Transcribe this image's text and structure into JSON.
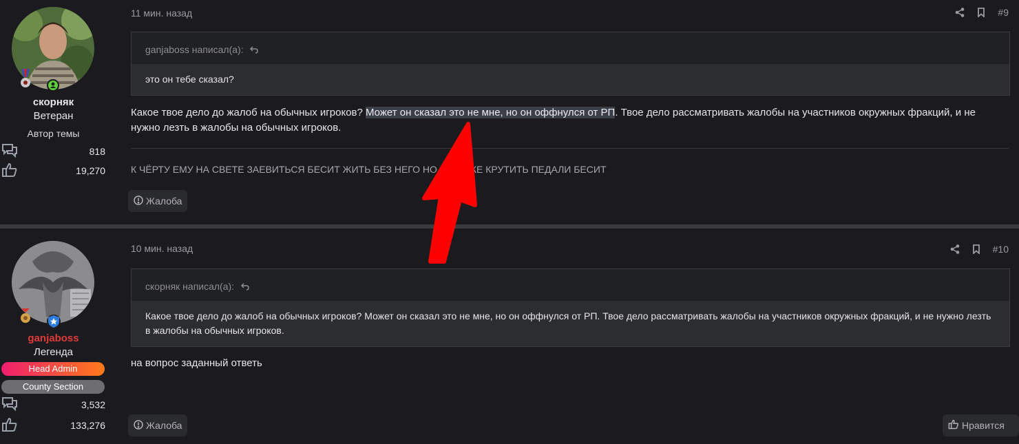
{
  "post1": {
    "author": {
      "name": "скорняк",
      "name_color": "#d9d9dd",
      "title": "Ветеран",
      "author_label": "Автор темы",
      "messages": "818",
      "reactions": "19,270"
    },
    "time": "11 мин. назад",
    "number": "#9",
    "quote": {
      "header": "ganjaboss написал(а):",
      "text": "это он тебе сказал?"
    },
    "message": {
      "before": "Какое твое дело до жалоб на обычных игроков? ",
      "highlight": "Может он сказал это не мне, но он оффнулся от РП",
      "after": ". Твое дело рассматривать жалобы на участников окружных фракций, и не нужно лезть в жалобы на обычных игроков."
    },
    "signature": "К ЧЁРТУ ЕМУ НА СВЕТЕ ЗАЕВИТЬСЯ БЕСИТ ЖИТЬ БЕЗ НЕГО НО НА ЯМКЕ КРУТИТЬ ПЕДАЛИ БЕСИТ",
    "report_label": "Жалоба"
  },
  "post2": {
    "author": {
      "name": "ganjaboss",
      "name_color": "#e03a3a",
      "title": "Легенда",
      "roles": [
        "Head Admin",
        "County Section"
      ],
      "messages": "3,532",
      "reactions": "133,276"
    },
    "time": "10 мин. назад",
    "number": "#10",
    "quote": {
      "header": "скорняк написал(а):",
      "text": "Какое твое дело до жалоб на обычных игроков? Может он сказал это не мне, но он оффнулся от РП. Твое дело рассматривать жалобы на участников окружных фракций, и не нужно лезть в жалобы на обычных игроков."
    },
    "message": "на вопрос заданный ответь",
    "report_label": "Жалоба",
    "like_label": "Нравится"
  },
  "icons": {
    "share": "share-icon",
    "bookmark": "bookmark-icon",
    "reply_link": "reply-arrow-icon",
    "report": "alert-circle-icon",
    "messages": "chat-bubbles-icon",
    "reactions": "thumbs-up-icon",
    "like": "thumbs-up-icon"
  },
  "colors": {
    "background": "#1b1b1f",
    "highlight": "#3c3f47",
    "head_admin_gradient": [
      "#ef1f6e",
      "#ff7a1a"
    ],
    "county_section": "#6e6e72",
    "annotation_arrow": "#ff0000"
  }
}
